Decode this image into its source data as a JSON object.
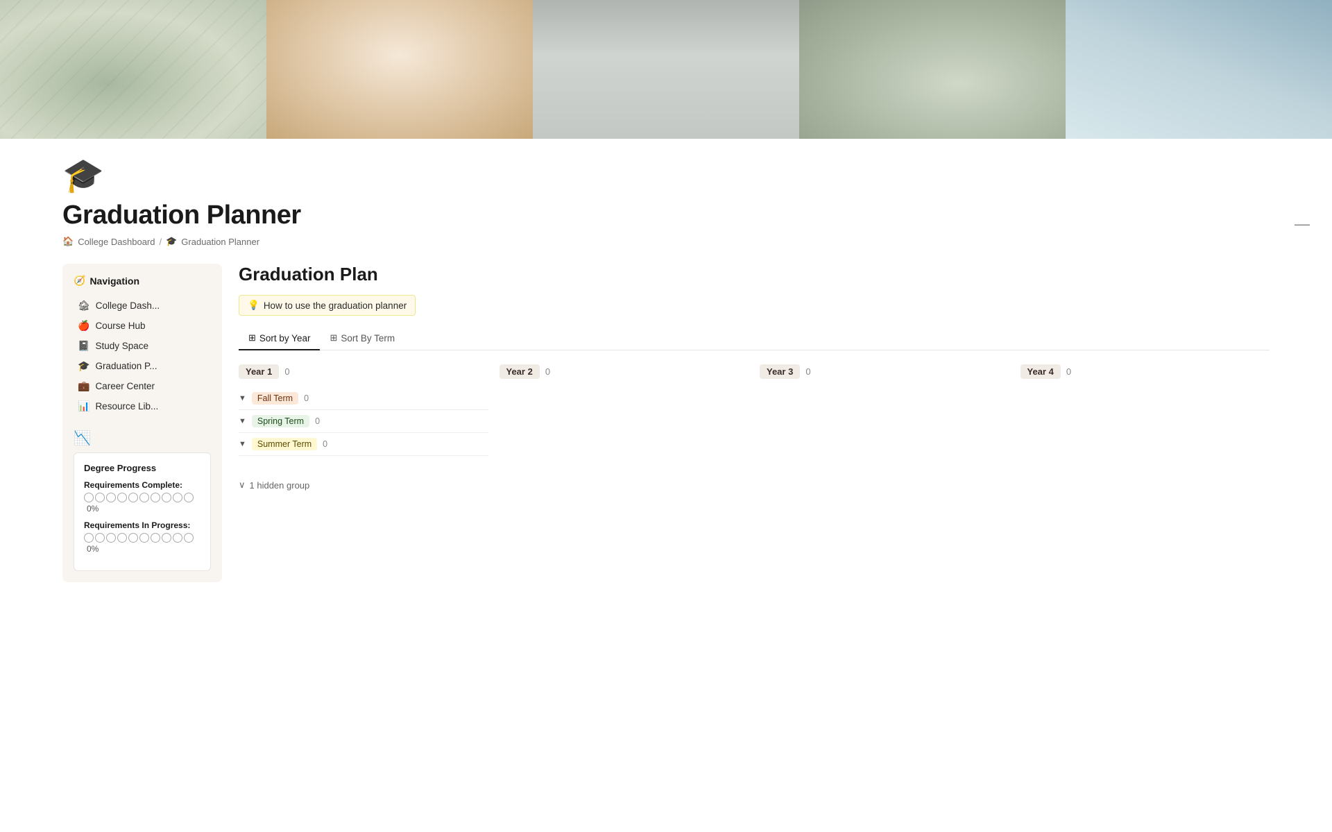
{
  "hero": {
    "images": [
      {
        "alt": "plant shadow on wall",
        "color": "#c8cfc0"
      },
      {
        "alt": "person holding coffee cup",
        "color": "#e8d8c4"
      },
      {
        "alt": "books on shelf",
        "color": "#c4c8c0"
      },
      {
        "alt": "succulent plants in pots",
        "color": "#b8c0b0"
      },
      {
        "alt": "modern building exterior",
        "color": "#a8c0c8"
      }
    ]
  },
  "page": {
    "icon": "🎓",
    "title": "Graduation Planner",
    "breadcrumb": {
      "home_icon": "🏠",
      "parent": "College Dashboard",
      "separator": "/",
      "cap_icon": "🎓",
      "current": "Graduation Planner"
    }
  },
  "sidebar": {
    "header_icon": "🧭",
    "header_label": "Navigation",
    "nav_items": [
      {
        "icon": "🏚",
        "label": "College Dash...",
        "id": "college-dash"
      },
      {
        "icon": "🍎",
        "label": "Course Hub",
        "id": "course-hub"
      },
      {
        "icon": "📓",
        "label": "Study Space",
        "id": "study-space"
      },
      {
        "icon": "🎓",
        "label": "Graduation P...",
        "id": "graduation-p"
      },
      {
        "icon": "💼",
        "label": "Career Center",
        "id": "career-center"
      },
      {
        "icon": "📊",
        "label": "Resource Lib...",
        "id": "resource-lib"
      }
    ]
  },
  "degree_progress": {
    "title": "Degree Progress",
    "requirements_complete_label": "Requirements Complete:",
    "requirements_complete_pct": "0%",
    "requirements_complete_circles": 10,
    "requirements_in_progress_label": "Requirements In Progress:",
    "requirements_in_progress_pct": "0%",
    "requirements_in_progress_circles": 10
  },
  "main": {
    "section_title": "Graduation Plan",
    "hint_icon": "💡",
    "hint_label": "How to use the graduation planner",
    "tabs": [
      {
        "icon": "⊞",
        "label": "Sort by Year",
        "active": true
      },
      {
        "icon": "⊞",
        "label": "Sort By Term",
        "active": false
      }
    ],
    "years": [
      {
        "label": "Year 1",
        "count": 0
      },
      {
        "label": "Year 2",
        "count": 0
      },
      {
        "label": "Year 3",
        "count": 0
      },
      {
        "label": "Year 4",
        "count": 0
      }
    ],
    "terms": [
      {
        "label": "Fall Term",
        "count": 0,
        "type": "fall"
      },
      {
        "label": "Spring Term",
        "count": 0,
        "type": "spring"
      },
      {
        "label": "Summer Term",
        "count": 0,
        "type": "summer"
      }
    ],
    "hidden_group": {
      "arrow": "∨",
      "label": "1 hidden group"
    }
  },
  "top_right": {
    "minus": "—"
  }
}
